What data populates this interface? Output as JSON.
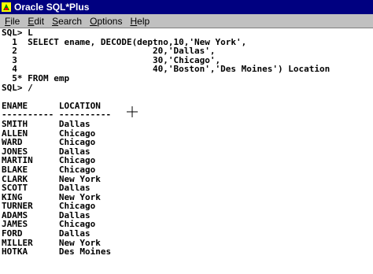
{
  "window": {
    "title": "Oracle SQL*Plus",
    "icon": "sqlplus-app-icon"
  },
  "menu": [
    {
      "label": "File",
      "mnemonic": "F",
      "rest": "ile"
    },
    {
      "label": "Edit",
      "mnemonic": "E",
      "rest": "dit"
    },
    {
      "label": "Search",
      "mnemonic": "S",
      "rest": "earch"
    },
    {
      "label": "Options",
      "mnemonic": "O",
      "rest": "ptions"
    },
    {
      "label": "Help",
      "mnemonic": "H",
      "rest": "elp"
    }
  ],
  "console": {
    "lines": [
      "SQL> L",
      "  1  SELECT ename, DECODE(deptno,10,'New York',",
      "  2                          20,'Dallas',",
      "  3                          30,'Chicago',",
      "  4                          40,'Boston','Des Moines') Location",
      "  5* FROM emp",
      "SQL> /",
      "",
      "ENAME      LOCATION",
      "---------- ----------",
      "SMITH      Dallas",
      "ALLEN      Chicago",
      "WARD       Chicago",
      "JONES      Dallas",
      "MARTIN     Chicago",
      "BLAKE      Chicago",
      "CLARK      New York",
      "SCOTT      Dallas",
      "KING       New York",
      "TURNER     Chicago",
      "ADAMS      Dallas",
      "JAMES      Chicago",
      "FORD       Dallas",
      "MILLER     New York",
      "HOTKA      Des Moines"
    ]
  },
  "colors": {
    "titlebar": "#000080",
    "menubar": "#c0c0c0",
    "console_bg": "#ffffff",
    "console_text": "#000000"
  },
  "pointer": "crosshair-cursor-icon"
}
